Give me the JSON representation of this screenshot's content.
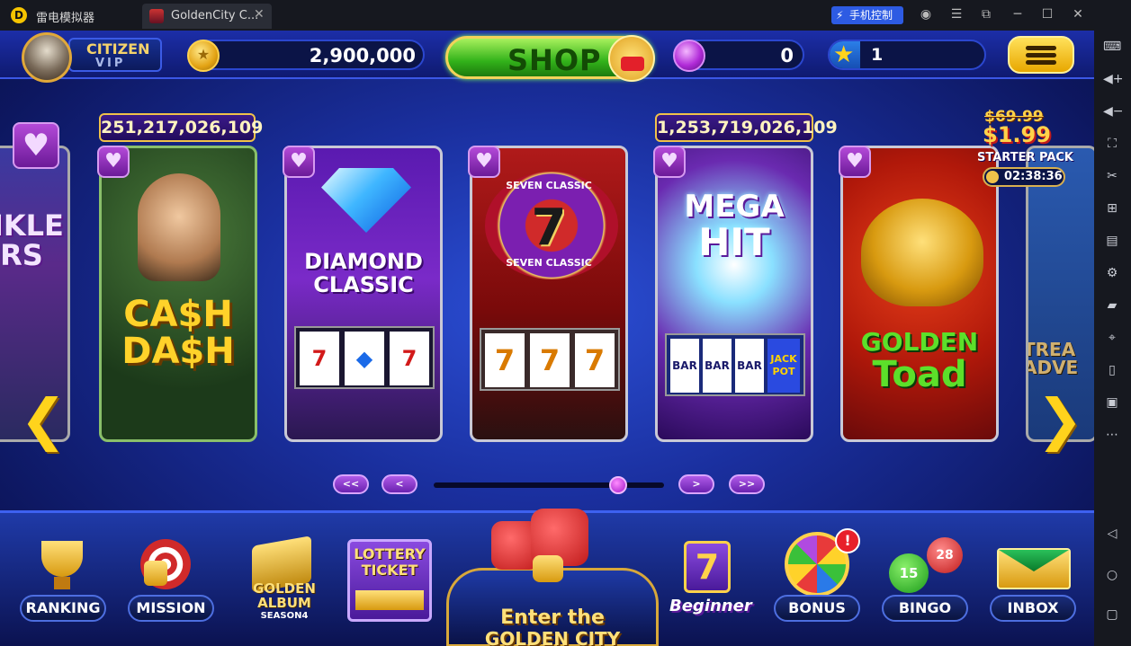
{
  "window": {
    "app_title": "雷电模拟器",
    "tab_title": "GoldenCity C...",
    "remote_control_label": "手机控制"
  },
  "header": {
    "rank_line1": "CITIZEN",
    "rank_line2": "VIP",
    "coins": "2,900,000",
    "shop_label": "SHOP",
    "gems": "0",
    "level": "1",
    "level_progress_pct": 20
  },
  "promo": {
    "old_price": "$69.99",
    "price": "$1.99",
    "label": "STARTER PACK",
    "timer": "02:38:36"
  },
  "games": [
    {
      "title": "CA$H DA$H",
      "jackpot": "251,217,026,109"
    },
    {
      "title_line1": "DIAMOND",
      "title_line2": "CLASSIC"
    },
    {
      "title_line1": "SEVEN CLASSIC",
      "title_line2": "7",
      "title_line3": "SEVEN CLASSIC"
    },
    {
      "title_line1": "MEGA",
      "title_line2": "HIT",
      "jackpot": "1,253,719,026,109",
      "reel_label": "JACK POT"
    },
    {
      "title_line1": "GOLDEN",
      "title_line2": "Toad"
    }
  ],
  "partial_cards": {
    "left_text": "NKLE RS",
    "right_text": "TREA ADVE"
  },
  "pager": {
    "first": "<<",
    "prev": "<",
    "next": ">",
    "last": ">>",
    "position_pct": 80
  },
  "dock": {
    "ranking": "RANKING",
    "mission": "MISSION",
    "album_line1": "GOLDEN",
    "album_line2": "ALBUM",
    "album_line3": "SEASON4",
    "lottery_line1": "LOTTERY",
    "lottery_line2": "TICKET",
    "center_line1": "Enter the",
    "center_line2": "GOLDEN CITY",
    "beginner": "Beginner",
    "bonus": "BONUS",
    "bonus_badge": "!",
    "bingo": "BINGO",
    "inbox": "INBOX",
    "bingo_ball1": "15",
    "bingo_ball2": "28"
  }
}
